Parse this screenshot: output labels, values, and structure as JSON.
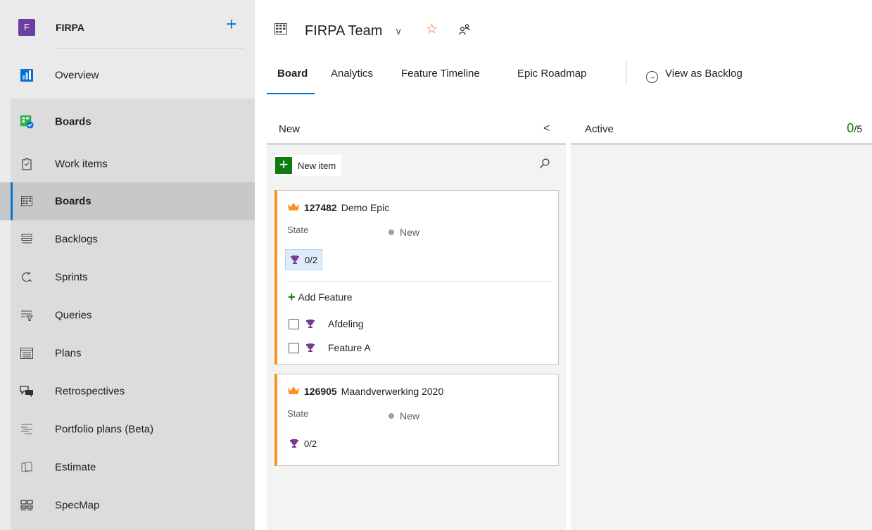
{
  "sidebar": {
    "project_initial": "F",
    "project_name": "FIRPA",
    "add_label": "+",
    "items": [
      {
        "label": "Overview"
      },
      {
        "label": "Boards"
      },
      {
        "label": "Work items"
      },
      {
        "label": "Boards"
      },
      {
        "label": "Backlogs"
      },
      {
        "label": "Sprints"
      },
      {
        "label": "Queries"
      },
      {
        "label": "Plans"
      },
      {
        "label": "Retrospectives"
      },
      {
        "label": "Portfolio plans (Beta)"
      },
      {
        "label": "Estimate"
      },
      {
        "label": "SpecMap"
      }
    ]
  },
  "header": {
    "team_name": "FIRPA Team",
    "chevron": "∨",
    "star": "☆"
  },
  "tabs": [
    {
      "label": "Board"
    },
    {
      "label": "Analytics"
    },
    {
      "label": "Feature Timeline"
    },
    {
      "label": "Epic Roadmap"
    }
  ],
  "view_as_backlog": "View as Backlog",
  "view_as_backlog_icon": "→",
  "columns": {
    "new": {
      "name": "New",
      "collapse_icon": "<",
      "new_item_label": "New item",
      "new_item_plus": "+"
    },
    "active": {
      "name": "Active",
      "wip_current": "0",
      "wip_limit": "/5"
    }
  },
  "cards": [
    {
      "id": "127482",
      "title": "Demo Epic",
      "state_label": "State",
      "state_value": "New",
      "progress": "0/2",
      "add_feature": "Add Feature",
      "add_feature_plus": "+",
      "children": [
        {
          "title": "Afdeling"
        },
        {
          "title": "Feature A"
        }
      ]
    },
    {
      "id": "126905",
      "title": "Maandverwerking 2020",
      "state_label": "State",
      "state_value": "New",
      "progress": "0/2"
    }
  ],
  "colors": {
    "accent": "#0078d4",
    "epic": "#f7931e",
    "feature": "#773b93",
    "add_green": "#107c10",
    "project_badge": "#6b3fa0"
  }
}
